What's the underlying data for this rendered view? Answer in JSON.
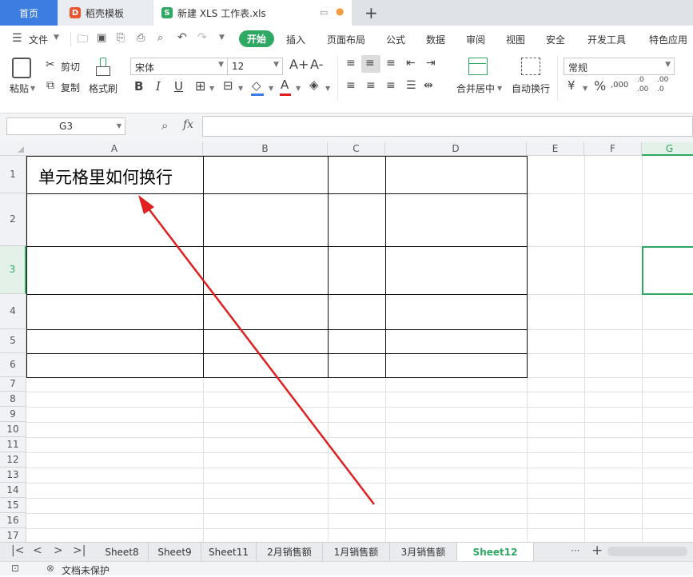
{
  "tabs": {
    "home": "首页",
    "template": "稻壳模板",
    "file": "新建 XLS 工作表.xls",
    "add": "+"
  },
  "menu": {
    "file": "文件",
    "items": [
      "开始",
      "插入",
      "页面布局",
      "公式",
      "数据",
      "审阅",
      "视图",
      "安全",
      "开发工具",
      "特色应用"
    ]
  },
  "ribbon": {
    "paste": "粘贴",
    "cut": "剪切",
    "copy": "复制",
    "format_painter": "格式刷",
    "font_name": "宋体",
    "font_size": "12",
    "bold": "B",
    "italic": "I",
    "underline": "U",
    "merge_center": "合并居中",
    "wrap_text": "自动换行",
    "number_format": "常规",
    "percent": "%",
    "currency": "¥",
    "font_color_letter": "A",
    "grow_font": "A+",
    "shrink_font": "A-",
    "dec_inc": ".00",
    "dec_dec": ".0"
  },
  "formula": {
    "namebox": "G3",
    "fx": "fx",
    "value": ""
  },
  "sheet": {
    "columns": [
      "A",
      "B",
      "C",
      "D",
      "E",
      "F",
      "G"
    ],
    "rows": [
      "1",
      "2",
      "3",
      "4",
      "5",
      "6",
      "7",
      "8",
      "9",
      "10",
      "11",
      "12",
      "13",
      "14",
      "15",
      "16",
      "17"
    ],
    "cell_a1": "单元格里如何换行",
    "active_col": "G",
    "active_row": "3"
  },
  "sheet_tabs": [
    "Sheet8",
    "Sheet9",
    "Sheet11",
    "2月销售额",
    "1月销售额",
    "3月销售额",
    "Sheet12"
  ],
  "active_sheet": "Sheet12",
  "status": {
    "protection": "文档未保护"
  },
  "colors": {
    "accent_green": "#2fa864",
    "tab_blue": "#3d7ce0",
    "annotation_red": "#e02020"
  }
}
